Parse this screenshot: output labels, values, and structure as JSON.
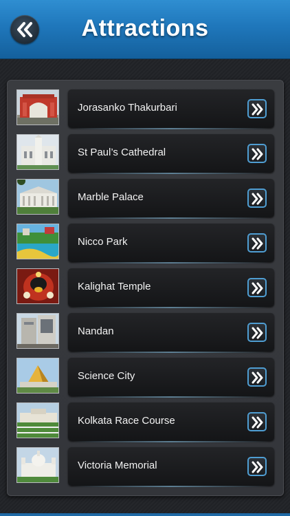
{
  "header": {
    "title": "Attractions",
    "back_icon": "double-chevron-left-icon"
  },
  "attractions": [
    {
      "label": "Jorasanko Thakurbari"
    },
    {
      "label": "St Paul’s Cathedral"
    },
    {
      "label": "Marble Palace"
    },
    {
      "label": "Nicco Park"
    },
    {
      "label": "Kalighat Temple"
    },
    {
      "label": "Nandan"
    },
    {
      "label": "Science City"
    },
    {
      "label": "Kolkata Race Course"
    },
    {
      "label": "Victoria Memorial"
    }
  ],
  "colors": {
    "header_blue": "#1f77bb",
    "accent_border": "#4f9ed3",
    "background": "#202226"
  }
}
